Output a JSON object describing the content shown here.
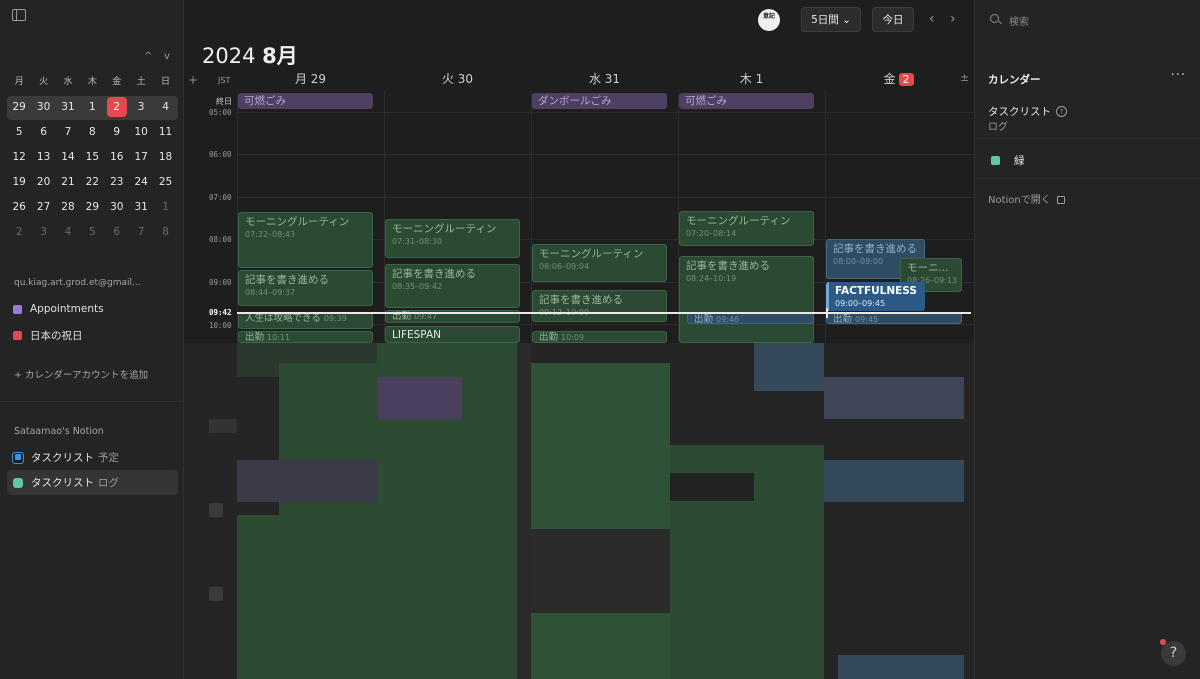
{
  "sidebar": {
    "weekdays": [
      "月",
      "火",
      "水",
      "木",
      "金",
      "土",
      "日"
    ],
    "weeks": [
      [
        "29",
        "30",
        "31",
        "1",
        "2",
        "3",
        "4"
      ],
      [
        "5",
        "6",
        "7",
        "8",
        "9",
        "10",
        "11"
      ],
      [
        "12",
        "13",
        "14",
        "15",
        "16",
        "17",
        "18"
      ],
      [
        "19",
        "20",
        "21",
        "22",
        "23",
        "24",
        "25"
      ],
      [
        "26",
        "27",
        "28",
        "29",
        "30",
        "31",
        "1"
      ],
      [
        "2",
        "3",
        "4",
        "5",
        "6",
        "7",
        "8"
      ]
    ],
    "nav_prev": "^",
    "nav_next": "v",
    "account_email": "qu.kiag.art.grod.et@gmail...",
    "calendars": [
      {
        "label": "Appointments",
        "color": "#9b7ad8"
      },
      {
        "label": "日本の祝日",
        "color": "#e5484d"
      }
    ],
    "add_account": "+ カレンダーアカウントを追加",
    "workspace": "Sataamao's Notion",
    "notion_items": [
      {
        "label": "タスクリスト",
        "sub": "予定"
      },
      {
        "label": "タスクリスト",
        "sub": "ログ"
      }
    ]
  },
  "toolbar": {
    "avatar_text": "意記",
    "view_label": "5日間 ⌄",
    "today_label": "今日",
    "prev": "‹",
    "next": "›"
  },
  "header": {
    "year": "2024",
    "month": "8月",
    "add": "+",
    "timezone": "JST",
    "allday": "終日",
    "plusminus": "±",
    "days": [
      {
        "dow": "月",
        "date": "29"
      },
      {
        "dow": "火",
        "date": "30"
      },
      {
        "dow": "水",
        "date": "31"
      },
      {
        "dow": "木",
        "date": "1"
      },
      {
        "dow": "金",
        "date": "2",
        "today": true
      }
    ]
  },
  "times": [
    "05:00",
    "06:00",
    "07:00",
    "08:00",
    "09:00",
    "10:00"
  ],
  "now_time": "09:42",
  "allday_events": [
    {
      "day": 0,
      "title": "可燃ごみ"
    },
    {
      "day": 2,
      "title": "ダンボールごみ"
    },
    {
      "day": 3,
      "title": "可燃ごみ"
    }
  ],
  "events": {
    "mon_routine": {
      "title": "モーニングルーティン",
      "time": "07:22–08:43"
    },
    "mon_article": {
      "title": "記事を書き進める",
      "time": "08:44–09:37"
    },
    "mon_life": {
      "title": "人生は攻略できる",
      "time": "09:39"
    },
    "mon_commute": {
      "title": "出勤",
      "time": "10:11"
    },
    "tue_routine": {
      "title": "モーニングルーティン",
      "time": "07:31–08:30"
    },
    "tue_article": {
      "title": "記事を書き進める",
      "time": "08:35–09:42"
    },
    "tue_commute": {
      "title": "出勤",
      "time": "09:47"
    },
    "tue_lifespan": {
      "title": "LIFESPAN"
    },
    "wed_routine": {
      "title": "モーニングルーティン",
      "time": "08:06–09:04"
    },
    "wed_article": {
      "title": "記事を書き進める",
      "time": "09:12–10:09"
    },
    "wed_commute": {
      "title": "出勤",
      "time": "10:09"
    },
    "thu_routine": {
      "title": "モーニングルーティン",
      "time": "07:20–08:14"
    },
    "thu_article": {
      "title": "記事を書き進める",
      "time": "08:24–10:19"
    },
    "thu_commute": {
      "title": "出勤",
      "time": "09:46"
    },
    "fri_article": {
      "title": "記事を書き進める",
      "time": "08:00–09:00"
    },
    "fri_routine": {
      "title": "モーニ...",
      "time": "08:26–09:13"
    },
    "fri_fact": {
      "title": "FACTFULNESS",
      "time": "09:00–09:45"
    },
    "fri_commute": {
      "title": "出勤",
      "time": "09:45"
    }
  },
  "right_panel": {
    "search_placeholder": "検索",
    "title": "カレンダー",
    "menu": "···",
    "tasklist_title": "タスクリスト",
    "tasklist_sub": "ログ",
    "help_q": "?",
    "color_label": "緑",
    "open_notion": "Notionで開く"
  },
  "help_label": "?"
}
